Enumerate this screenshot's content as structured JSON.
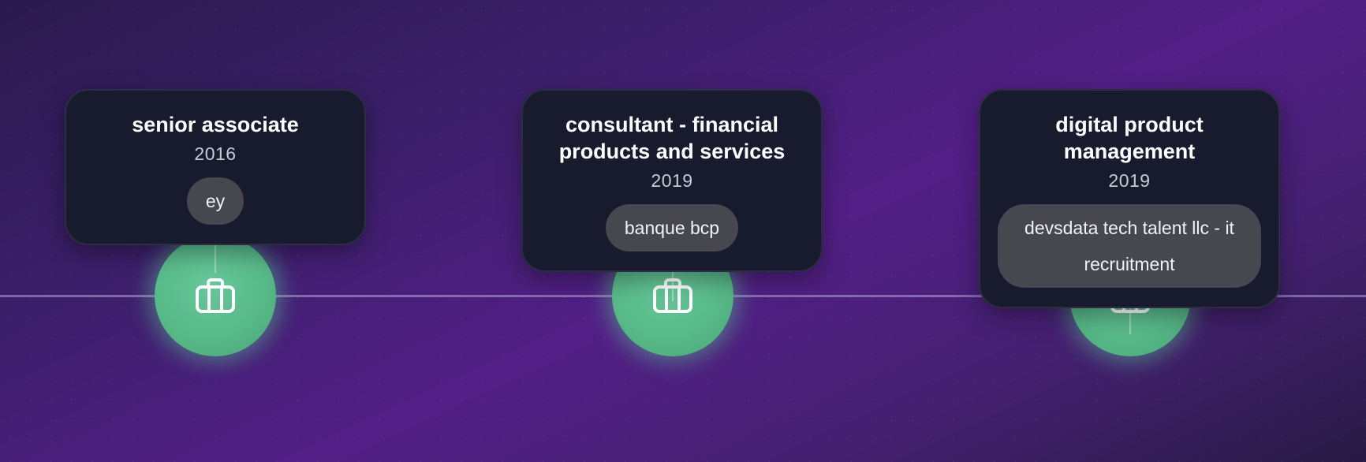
{
  "timeline": {
    "items": [
      {
        "title": "senior associate",
        "year": "2016",
        "company": "ey",
        "icon": "briefcase-icon"
      },
      {
        "title": "consultant - financial products and services",
        "year": "2019",
        "company": "banque bcp",
        "icon": "briefcase-icon"
      },
      {
        "title": "digital product management",
        "year": "2019",
        "company": "devsdata tech talent llc - it recruitment",
        "icon": "briefcase-icon"
      }
    ]
  },
  "colors": {
    "node_fill": "#58b989",
    "card_background": "#181a2d",
    "pill_background": "#46474f",
    "line": "#c4b0e8"
  }
}
